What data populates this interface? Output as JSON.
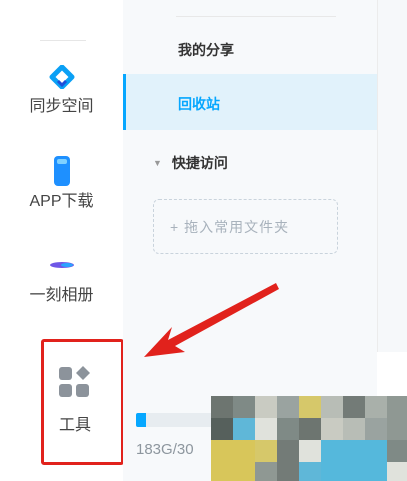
{
  "rail": {
    "items": [
      {
        "label": "同步空间",
        "icon": "sync-diamond-icon"
      },
      {
        "label": "APP下载",
        "icon": "phone-icon"
      },
      {
        "label": "一刻相册",
        "icon": "album-swoosh-icon"
      },
      {
        "label": "工具",
        "icon": "tools-grid-icon"
      }
    ]
  },
  "nav": {
    "top_partial": "...",
    "my_share": "我的分享",
    "recycle": "回收站",
    "quick_access": "快捷访问",
    "drop_hint": "+ 拖入常用文件夹"
  },
  "storage": {
    "text": "183G/30",
    "used_fraction": 0.13
  },
  "colors": {
    "accent": "#06a7ff",
    "highlight_red": "#e1221c",
    "selected_bg": "#e1f2fb"
  }
}
